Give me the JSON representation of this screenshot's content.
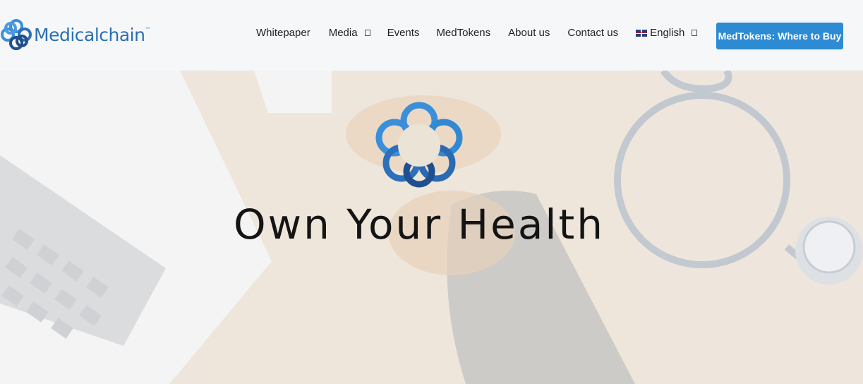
{
  "header": {
    "logo_text": "Medicalchain",
    "logo_tm": "™",
    "nav": [
      {
        "label": "Whitepaper"
      },
      {
        "label": "Media"
      },
      {
        "label": "Events"
      },
      {
        "label": "MedTokens"
      },
      {
        "label": "About us"
      },
      {
        "label": "Contact us"
      },
      {
        "label": "English"
      }
    ],
    "cta_label": "MedTokens: Where to Buy"
  },
  "hero": {
    "title": "Own Your Health"
  },
  "colors": {
    "brand_blue": "#2d8bd4",
    "logo_blue": "#2a6fb4",
    "title": "#141414"
  },
  "icons": {
    "logo": "medicalchain-logo-icon",
    "emblem": "medicalchain-emblem-icon",
    "dropdown": "chevron-down-icon",
    "flag": "uk-flag-icon"
  }
}
